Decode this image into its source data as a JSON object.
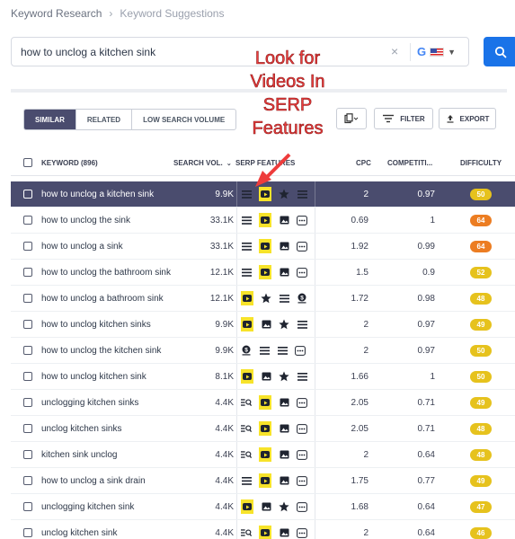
{
  "breadcrumb": {
    "root": "Keyword Research",
    "current": "Keyword Suggestions"
  },
  "search": {
    "query": "how to unclog a kitchen sink",
    "engine": "G"
  },
  "tabs": [
    "SIMILAR",
    "RELATED",
    "LOW SEARCH VOLUME"
  ],
  "toolbar": {
    "filter": "FILTER",
    "export": "EXPORT"
  },
  "annotation": {
    "lines": [
      "Look for",
      "Videos In",
      "SERP",
      "Features"
    ],
    "color": "#ee3c3c"
  },
  "table": {
    "headers": {
      "keyword": "KEYWORD (896)",
      "volume": "SEARCH VOL.",
      "features": "SERP FEATURES",
      "cpc": "CPC",
      "competition": "COMPETITI...",
      "difficulty": "DIFFICULTY"
    },
    "rows": [
      {
        "keyword": "how to unclog a kitchen sink",
        "volume": "9.9K",
        "features": [
          "list",
          "video",
          "star",
          "list"
        ],
        "video_hl": true,
        "cpc": "2",
        "competition": "0.97",
        "difficulty": "50",
        "diff_color": "#e6c21d",
        "active": true
      },
      {
        "keyword": "how to unclog the sink",
        "volume": "33.1K",
        "features": [
          "list",
          "video",
          "image",
          "more"
        ],
        "video_hl": true,
        "cpc": "0.69",
        "competition": "1",
        "difficulty": "64",
        "diff_color": "#ec7d22"
      },
      {
        "keyword": "how to unclog a sink",
        "volume": "33.1K",
        "features": [
          "list",
          "video",
          "image",
          "more"
        ],
        "video_hl": true,
        "cpc": "1.92",
        "competition": "0.99",
        "difficulty": "64",
        "diff_color": "#ec7d22"
      },
      {
        "keyword": "how to unclog the bathroom sink",
        "volume": "12.1K",
        "features": [
          "list",
          "video",
          "image",
          "more"
        ],
        "video_hl": true,
        "cpc": "1.5",
        "competition": "0.9",
        "difficulty": "52",
        "diff_color": "#e6c21d"
      },
      {
        "keyword": "how to unclog a bathroom sink",
        "volume": "12.1K",
        "features": [
          "video",
          "star",
          "list",
          "dollar"
        ],
        "video_hl": true,
        "cpc": "1.72",
        "competition": "0.98",
        "difficulty": "48",
        "diff_color": "#e6c21d"
      },
      {
        "keyword": "how to unclog kitchen sinks",
        "volume": "9.9K",
        "features": [
          "video",
          "image",
          "star",
          "list"
        ],
        "video_hl": true,
        "cpc": "2",
        "competition": "0.97",
        "difficulty": "49",
        "diff_color": "#e6c21d"
      },
      {
        "keyword": "how to unclog the kitchen sink",
        "volume": "9.9K",
        "features": [
          "dollar",
          "list",
          "list",
          "more"
        ],
        "video_hl": false,
        "cpc": "2",
        "competition": "0.97",
        "difficulty": "50",
        "diff_color": "#e6c21d"
      },
      {
        "keyword": "how to unclog kitchen sink",
        "volume": "8.1K",
        "features": [
          "video",
          "image",
          "star",
          "list"
        ],
        "video_hl": true,
        "cpc": "1.66",
        "competition": "1",
        "difficulty": "50",
        "diff_color": "#e6c21d"
      },
      {
        "keyword": "unclogging kitchen sinks",
        "volume": "4.4K",
        "features": [
          "faq",
          "video",
          "image",
          "more"
        ],
        "video_hl": true,
        "cpc": "2.05",
        "competition": "0.71",
        "difficulty": "49",
        "diff_color": "#e6c21d"
      },
      {
        "keyword": "unclog kitchen sinks",
        "volume": "4.4K",
        "features": [
          "faq",
          "video",
          "image",
          "more"
        ],
        "video_hl": true,
        "cpc": "2.05",
        "competition": "0.71",
        "difficulty": "48",
        "diff_color": "#e6c21d"
      },
      {
        "keyword": "kitchen sink unclog",
        "volume": "4.4K",
        "features": [
          "faq",
          "video",
          "image",
          "more"
        ],
        "video_hl": true,
        "cpc": "2",
        "competition": "0.64",
        "difficulty": "48",
        "diff_color": "#e6c21d"
      },
      {
        "keyword": "how to unclog a sink drain",
        "volume": "4.4K",
        "features": [
          "list",
          "video",
          "image",
          "more"
        ],
        "video_hl": true,
        "cpc": "1.75",
        "competition": "0.77",
        "difficulty": "49",
        "diff_color": "#e6c21d"
      },
      {
        "keyword": "unclogging kitchen sink",
        "volume": "4.4K",
        "features": [
          "video",
          "image",
          "star",
          "more"
        ],
        "video_hl": true,
        "cpc": "1.68",
        "competition": "0.64",
        "difficulty": "47",
        "diff_color": "#e6c21d"
      },
      {
        "keyword": "unclog kitchen sink",
        "volume": "4.4K",
        "features": [
          "faq",
          "video",
          "image",
          "more"
        ],
        "video_hl": true,
        "cpc": "2",
        "competition": "0.64",
        "difficulty": "46",
        "diff_color": "#e6c21d"
      }
    ]
  }
}
